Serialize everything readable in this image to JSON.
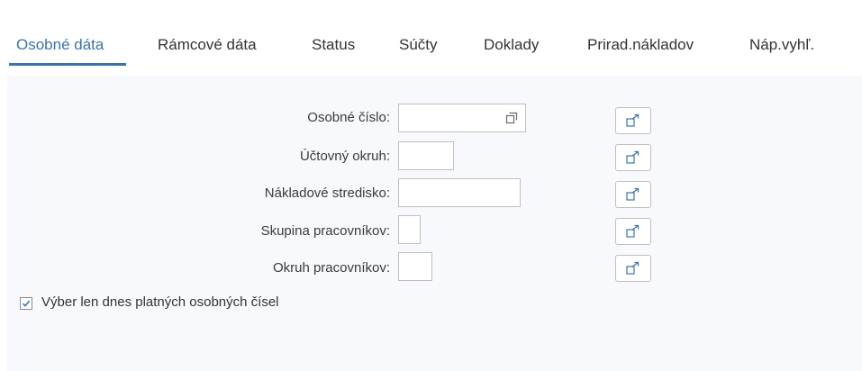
{
  "tabs": [
    {
      "label": "Osobné dáta",
      "active": true
    },
    {
      "label": "Rámcové dáta",
      "active": false
    },
    {
      "label": "Status",
      "active": false
    },
    {
      "label": "Súčty",
      "active": false
    },
    {
      "label": "Doklady",
      "active": false
    },
    {
      "label": "Prirad.nákladov",
      "active": false
    },
    {
      "label": "Náp.vyhľ.",
      "active": false
    }
  ],
  "form": {
    "fields": [
      {
        "label": "Osobné číslo:",
        "value": "",
        "icon": "value-help-icon"
      },
      {
        "label": "Účtovný okruh:",
        "value": ""
      },
      {
        "label": "Nákladové stredisko:",
        "value": ""
      },
      {
        "label": "Skupina pracovníkov:",
        "value": ""
      },
      {
        "label": "Okruh pracovníkov:",
        "value": ""
      }
    ],
    "multiple_selection_icon": "multiple-selection-icon"
  },
  "checkbox": {
    "label": "Výber len dnes platných osobných čísel",
    "checked": true
  },
  "colors": {
    "accent": "#3a74ad",
    "panel_bg": "#f7f9fc",
    "border": "#bfbfbf"
  }
}
